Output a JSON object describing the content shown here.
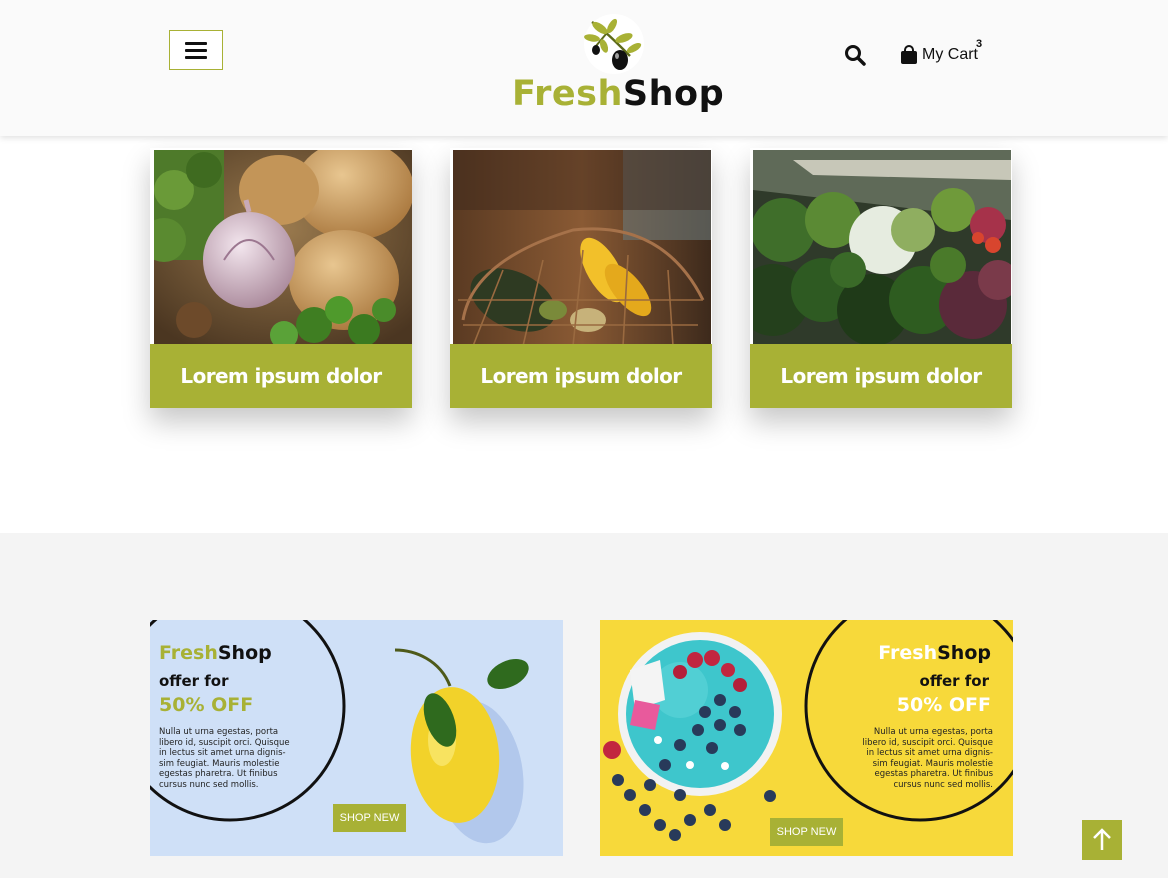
{
  "header": {
    "logo": {
      "part1": "Fresh",
      "part2": "Shop"
    },
    "cart": {
      "label": "My Cart",
      "count": "3"
    },
    "icons": {
      "menu": "hamburger-icon",
      "search": "search-icon",
      "cart": "shopping-bag-icon"
    }
  },
  "categories": [
    {
      "label": "Lorem ipsum dolor",
      "image": "garlic-potatoes-herbs"
    },
    {
      "label": "Lorem ipsum dolor",
      "image": "vegetable-basket"
    },
    {
      "label": "Lorem ipsum dolor",
      "image": "produce-shelf-greens"
    }
  ],
  "offers": [
    {
      "brand_part1": "Fresh",
      "brand_part2": "Shop",
      "subtitle": "offer for",
      "discount": "50% OFF",
      "body_lines": [
        "Nulla ut urna egestas, porta",
        "libero id, suscipit orci. Quisque",
        "in lectus sit amet urna dignis-",
        "sim feugiat. Mauris molestie",
        "egestas pharetra. Ut finibus",
        "cursus nunc sed mollis."
      ],
      "button": "SHOP NEW",
      "image": "lemon"
    },
    {
      "brand_part1": "Fresh",
      "brand_part2": "Shop",
      "subtitle": "offer for",
      "discount": "50% OFF",
      "body_lines": [
        "Nulla ut urna egestas, porta",
        "libero id, suscipit orci. Quisque",
        "in lectus sit amet urna dignis-",
        "sim feugiat. Mauris molestie",
        "egestas pharetra. Ut finibus",
        "cursus nunc sed mollis."
      ],
      "button": "SHOP NEW",
      "image": "smoothie-bowl"
    }
  ],
  "back_to_top": {
    "icon": "arrow-up-icon"
  },
  "colors": {
    "accent": "#a8b135",
    "header_bg": "#fafafa",
    "band_bg": "#f4f4f4",
    "banner1_bg": "#cfe0f7",
    "banner2_bg": "#f7d93a"
  }
}
